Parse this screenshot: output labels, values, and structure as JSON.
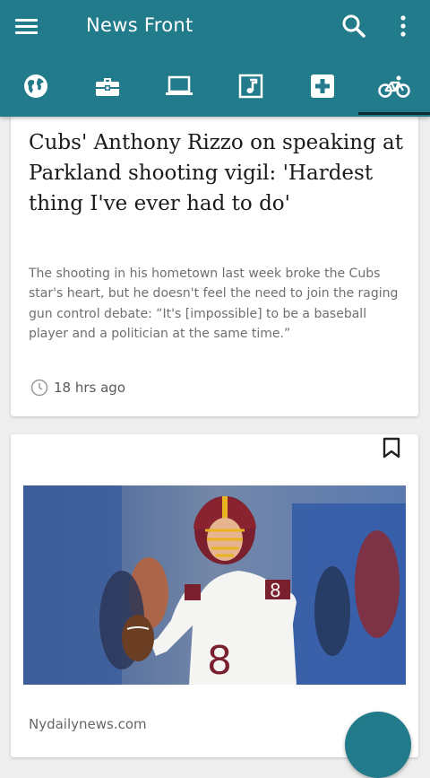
{
  "app": {
    "title": "News Front"
  },
  "toolbar": {
    "menu_icon": "menu-icon",
    "search_icon": "search-icon",
    "more_icon": "more-vert-icon"
  },
  "tabs": [
    {
      "icon": "globe-icon",
      "selected": false
    },
    {
      "icon": "briefcase-icon",
      "selected": false
    },
    {
      "icon": "laptop-icon",
      "selected": false
    },
    {
      "icon": "music-note-icon",
      "selected": false
    },
    {
      "icon": "medical-cross-icon",
      "selected": false
    },
    {
      "icon": "bicycle-icon",
      "selected": true
    }
  ],
  "articles": [
    {
      "headline": "Cubs' Anthony Rizzo on speaking at Parkland shooting vigil: 'Hardest thing I've ever had to do'",
      "summary": "The shooting in his hometown last week broke the Cubs star's heart, but he doesn't feel the need to join the raging gun control debate: “It's [impossible] to be a baseball player and a politician at the same time.”",
      "time": "18 hrs ago"
    },
    {
      "source": "Nydailynews.com",
      "image_subject": "football quarterback in burgundy and gold uniform throwing a pass",
      "jersey_number": "8"
    }
  ],
  "colors": {
    "primary": "#227b8a",
    "indicator": "#0f2a30",
    "background": "#eeeeee"
  }
}
